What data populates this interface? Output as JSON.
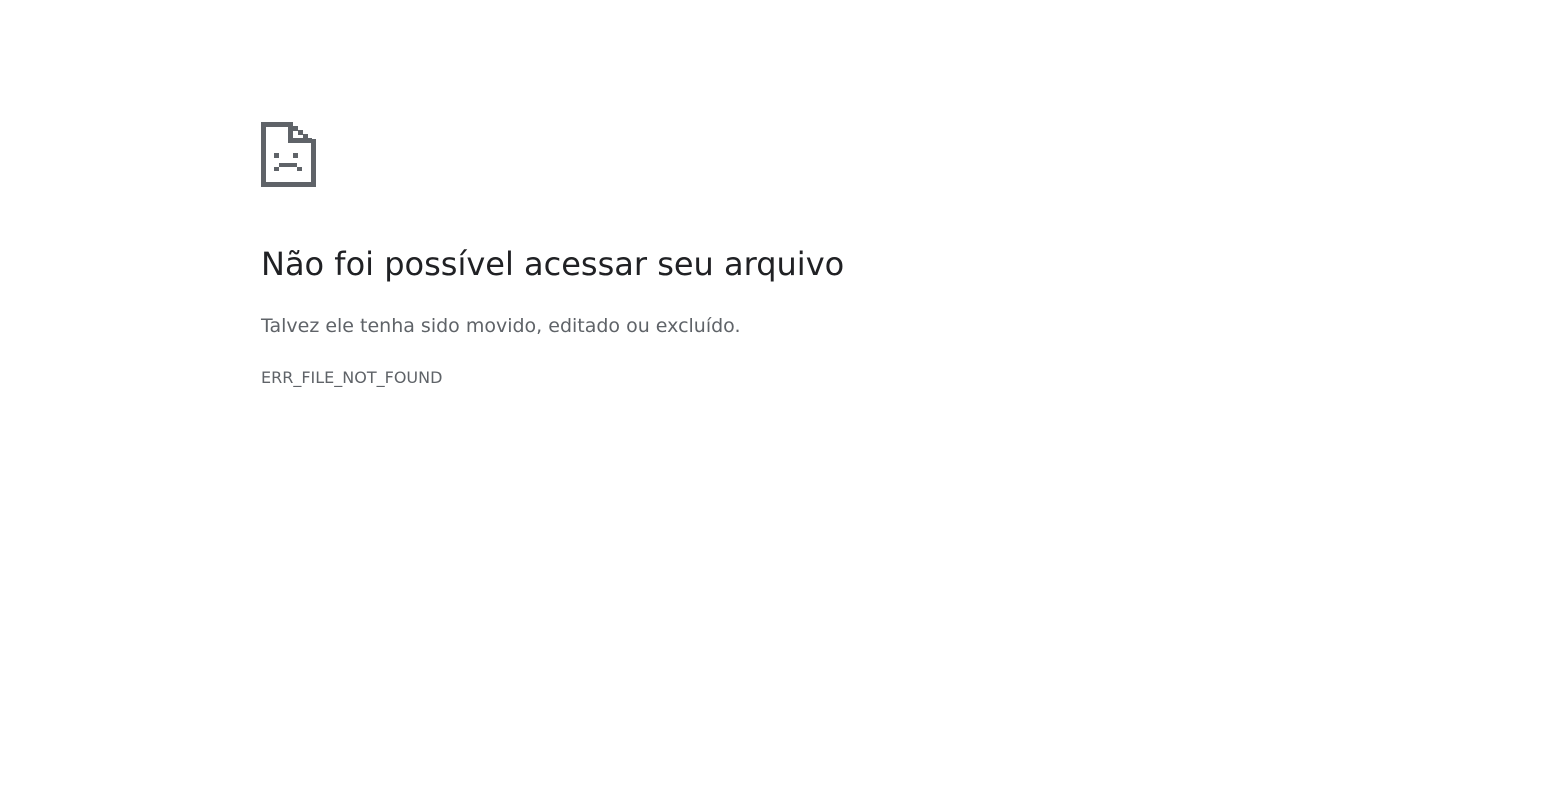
{
  "icon": {
    "name": "sad-document-icon",
    "color": "#5f6368"
  },
  "error": {
    "title": "Não foi possível acessar seu arquivo",
    "message": "Talvez ele tenha sido movido, editado ou excluído.",
    "code": "ERR_FILE_NOT_FOUND"
  },
  "colors": {
    "title": "#202124",
    "text": "#5f6368",
    "background": "#ffffff"
  }
}
